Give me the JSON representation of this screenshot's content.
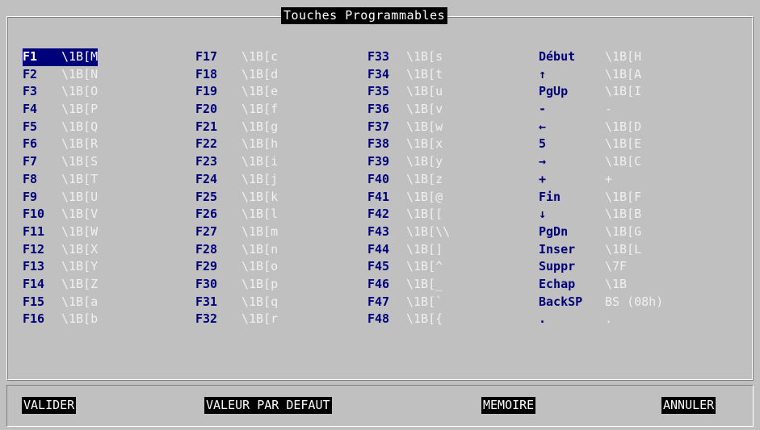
{
  "dialog": {
    "title": "Touches Programmables"
  },
  "columns": [
    [
      {
        "key": "F1",
        "value": "\\1B[M",
        "selected": true
      },
      {
        "key": "F2",
        "value": "\\1B[N"
      },
      {
        "key": "F3",
        "value": "\\1B[O"
      },
      {
        "key": "F4",
        "value": "\\1B[P"
      },
      {
        "key": "F5",
        "value": "\\1B[Q"
      },
      {
        "key": "F6",
        "value": "\\1B[R"
      },
      {
        "key": "F7",
        "value": "\\1B[S"
      },
      {
        "key": "F8",
        "value": "\\1B[T"
      },
      {
        "key": "F9",
        "value": "\\1B[U"
      },
      {
        "key": "F10",
        "value": "\\1B[V"
      },
      {
        "key": "F11",
        "value": "\\1B[W"
      },
      {
        "key": "F12",
        "value": "\\1B[X"
      },
      {
        "key": "F13",
        "value": "\\1B[Y"
      },
      {
        "key": "F14",
        "value": "\\1B[Z"
      },
      {
        "key": "F15",
        "value": "\\1B[a"
      },
      {
        "key": "F16",
        "value": "\\1B[b"
      }
    ],
    [
      {
        "key": "F17",
        "value": "\\1B[c"
      },
      {
        "key": "F18",
        "value": "\\1B[d"
      },
      {
        "key": "F19",
        "value": "\\1B[e"
      },
      {
        "key": "F20",
        "value": "\\1B[f"
      },
      {
        "key": "F21",
        "value": "\\1B[g"
      },
      {
        "key": "F22",
        "value": "\\1B[h"
      },
      {
        "key": "F23",
        "value": "\\1B[i"
      },
      {
        "key": "F24",
        "value": "\\1B[j"
      },
      {
        "key": "F25",
        "value": "\\1B[k"
      },
      {
        "key": "F26",
        "value": "\\1B[l"
      },
      {
        "key": "F27",
        "value": "\\1B[m"
      },
      {
        "key": "F28",
        "value": "\\1B[n"
      },
      {
        "key": "F29",
        "value": "\\1B[o"
      },
      {
        "key": "F30",
        "value": "\\1B[p"
      },
      {
        "key": "F31",
        "value": "\\1B[q"
      },
      {
        "key": "F32",
        "value": "\\1B[r"
      }
    ],
    [
      {
        "key": "F33",
        "value": "\\1B[s"
      },
      {
        "key": "F34",
        "value": "\\1B[t"
      },
      {
        "key": "F35",
        "value": "\\1B[u"
      },
      {
        "key": "F36",
        "value": "\\1B[v"
      },
      {
        "key": "F37",
        "value": "\\1B[w"
      },
      {
        "key": "F38",
        "value": "\\1B[x"
      },
      {
        "key": "F39",
        "value": "\\1B[y"
      },
      {
        "key": "F40",
        "value": "\\1B[z"
      },
      {
        "key": "F41",
        "value": "\\1B[@"
      },
      {
        "key": "F42",
        "value": "\\1B[["
      },
      {
        "key": "F43",
        "value": "\\1B[\\\\"
      },
      {
        "key": "F44",
        "value": "\\1B[]"
      },
      {
        "key": "F45",
        "value": "\\1B[^"
      },
      {
        "key": "F46",
        "value": "\\1B[_"
      },
      {
        "key": "F47",
        "value": "\\1B[`"
      },
      {
        "key": "F48",
        "value": "\\1B[{"
      }
    ],
    [
      {
        "key": "Début",
        "value": "\\1B[H"
      },
      {
        "key": "↑",
        "value": "\\1B[A"
      },
      {
        "key": "PgUp",
        "value": "\\1B[I"
      },
      {
        "key": "-",
        "value": "-"
      },
      {
        "key": "←",
        "value": "\\1B[D"
      },
      {
        "key": "5",
        "value": "\\1B[E"
      },
      {
        "key": "→",
        "value": "\\1B[C"
      },
      {
        "key": "+",
        "value": "+"
      },
      {
        "key": "Fin",
        "value": "\\1B[F"
      },
      {
        "key": "↓",
        "value": "\\1B[B"
      },
      {
        "key": "PgDn",
        "value": "\\1B[G"
      },
      {
        "key": "Inser",
        "value": "\\1B[L"
      },
      {
        "key": "Suppr",
        "value": "\\7F"
      },
      {
        "key": "Echap",
        "value": "\\1B"
      },
      {
        "key": "BackSP",
        "value": "BS (08h)"
      },
      {
        "key": ".",
        "value": "."
      }
    ]
  ],
  "buttons": {
    "validate": "VALIDER",
    "default": "VALEUR PAR DEFAUT",
    "memory": "MEMOIRE",
    "cancel": "ANNULER"
  }
}
